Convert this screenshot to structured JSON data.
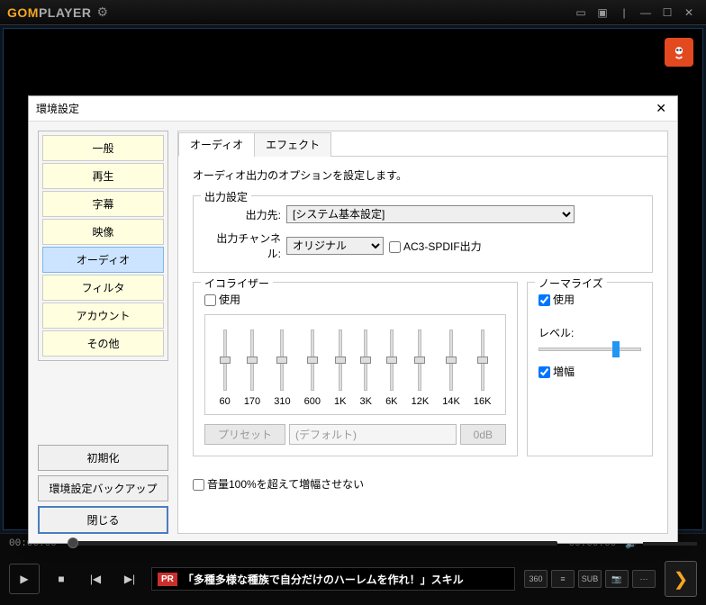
{
  "app": {
    "logo_main": "GOM",
    "logo_sub": "PLAYER"
  },
  "dialog": {
    "title": "環境設定",
    "categories": [
      "一般",
      "再生",
      "字幕",
      "映像",
      "オーディオ",
      "フィルタ",
      "アカウント",
      "その他"
    ],
    "selected_index": 4,
    "buttons": {
      "reset": "初期化",
      "backup": "環境設定バックアップ",
      "close": "閉じる"
    }
  },
  "tabs": {
    "items": [
      "オーディオ",
      "エフェクト"
    ],
    "active": 0
  },
  "desc": "オーディオ出力のオプションを設定します。",
  "output": {
    "title": "出力設定",
    "dest_label": "出力先:",
    "dest_value": "[システム基本設定]",
    "channel_label": "出力チャンネル:",
    "channel_value": "オリジナル",
    "ac3_label": "AC3-SPDIF出力"
  },
  "eq": {
    "title": "イコライザー",
    "use_label": "使用",
    "bands": [
      "60",
      "170",
      "310",
      "600",
      "1K",
      "3K",
      "6K",
      "12K",
      "14K",
      "16K"
    ],
    "preset_btn": "プリセット",
    "preset_value": "(デフォルト)",
    "db_btn": "0dB"
  },
  "norm": {
    "title": "ノーマライズ",
    "use_label": "使用",
    "use_checked": true,
    "level_label": "レベル:",
    "amp_label": "増幅",
    "amp_checked": true
  },
  "bottom_check": "音量100%を超えて増幅させない",
  "player": {
    "time_left": "00:00:00",
    "time_right": "00:00:00",
    "news_pr": "PR",
    "news_text": "「多種多様な種族で自分だけのハーレムを作れ！」スキル",
    "sm": {
      "rot": "360",
      "list": "≡",
      "sub": "SUB",
      "cam": "📷",
      "menu": "⋯"
    }
  }
}
